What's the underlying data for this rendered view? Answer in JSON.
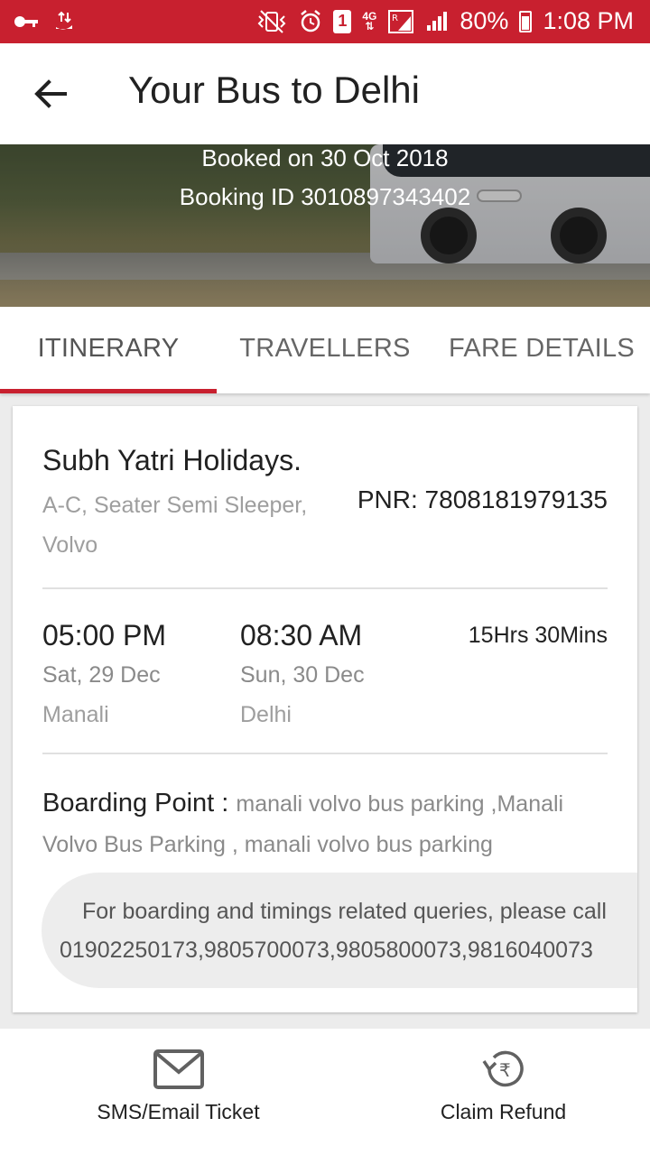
{
  "status_bar": {
    "battery": "80%",
    "time": "1:08 PM",
    "sim_slot": "1",
    "network": "4G"
  },
  "app_bar": {
    "title": "Your Bus to Delhi"
  },
  "hero": {
    "booked_on": "Booked on 30 Oct 2018",
    "booking_id": "Booking ID 3010897343402"
  },
  "tabs": [
    {
      "label": "ITINERARY",
      "active": true
    },
    {
      "label": "TRAVELLERS",
      "active": false
    },
    {
      "label": "FARE DETAILS",
      "active": false
    }
  ],
  "itinerary": {
    "operator": "Subh Yatri Holidays.",
    "bus_type": "A-C, Seater Semi Sleeper, Volvo",
    "pnr": "PNR: 7808181979135",
    "departure": {
      "time": "05:00 PM",
      "date": "Sat, 29 Dec",
      "city": "Manali"
    },
    "arrival": {
      "time": "08:30 AM",
      "date": "Sun, 30 Dec",
      "city": "Delhi"
    },
    "duration": "15Hrs 30Mins",
    "boarding_label": "Boarding Point : ",
    "boarding_value": "manali volvo bus parking ,Manali Volvo Bus Parking , manali volvo bus parking",
    "queries_line1": "For boarding and timings related queries, please call",
    "queries_line2": "01902250173,9805700073,9805800073,9816040073"
  },
  "bottom_bar": {
    "sms_label": "SMS/Email Ticket",
    "refund_label": "Claim Refund"
  },
  "colors": {
    "brand": "#c8202f",
    "tab_indicator": "#c8202f"
  }
}
